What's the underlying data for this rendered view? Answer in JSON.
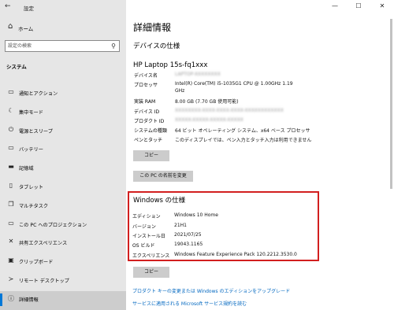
{
  "titlebar": {
    "back_icon": "back-arrow-icon",
    "app_title": "設定"
  },
  "sidebar": {
    "home_label": "ホーム",
    "search_placeholder": "設定の検索",
    "section_label": "システム",
    "items": [
      {
        "label": "通知とアクション",
        "icon": "notification-icon"
      },
      {
        "label": "集中モード",
        "icon": "moon-icon"
      },
      {
        "label": "電源とスリープ",
        "icon": "power-icon"
      },
      {
        "label": "バッテリー",
        "icon": "battery-icon"
      },
      {
        "label": "記憶域",
        "icon": "storage-icon"
      },
      {
        "label": "タブレット",
        "icon": "tablet-icon"
      },
      {
        "label": "マルチタスク",
        "icon": "multitask-icon"
      },
      {
        "label": "この PC へのプロジェクション",
        "icon": "projection-icon"
      },
      {
        "label": "共有エクスペリエンス",
        "icon": "share-icon"
      },
      {
        "label": "クリップボード",
        "icon": "clipboard-icon"
      },
      {
        "label": "リモート デスクトップ",
        "icon": "remote-desktop-icon"
      },
      {
        "label": "詳細情報",
        "icon": "info-icon",
        "selected": true
      }
    ]
  },
  "window_controls": {
    "minimize": "—",
    "maximize": "☐",
    "close": "✕"
  },
  "main": {
    "page_title": "詳細情報",
    "device_section_title": "デバイスの仕様",
    "device_name": "HP Laptop 15s-fq1xxx",
    "device_specs": [
      {
        "label": "デバイス名",
        "value": "LAPTOP-XXXXXXXX",
        "blurred": true
      },
      {
        "label": "プロセッサ",
        "value": "Intel(R) Core(TM) i5-1035G1 CPU @ 1.00GHz   1.19",
        "value2": "GHz"
      },
      {
        "label": "実装 RAM",
        "value": "8.00 GB (7.70 GB 使用可能)"
      },
      {
        "label": "デバイス ID",
        "value": "XXXXXXXX-XXXX-XXXX-XXXX-XXXXXXXXXXXX",
        "blurred": true
      },
      {
        "label": "プロダクト ID",
        "value": "XXXXX-XXXXX-XXXXX-XXXXX",
        "blurred": true
      },
      {
        "label": "システムの種類",
        "value": "64 ビット オペレーティング システム、x64 ベース プロセッサ"
      },
      {
        "label": "ペンとタッチ",
        "value": "このディスプレイでは、ペン入力とタッチ入力は利用できません"
      }
    ],
    "copy_button": "コピー",
    "rename_button": "この PC の名前を変更",
    "windows_section_title": "Windows の仕様",
    "windows_specs": [
      {
        "label": "エディション",
        "value": "Windows 10 Home"
      },
      {
        "label": "バージョン",
        "value": "21H1"
      },
      {
        "label": "インストール日",
        "value": "2021/07/25"
      },
      {
        "label": "OS ビルド",
        "value": "19043.1165"
      },
      {
        "label": "エクスペリエンス",
        "value": "Windows Feature Experience Pack 120.2212.3530.0"
      }
    ],
    "copy_button_2": "コピー",
    "links": [
      "プロダクト キーの変更または Windows のエディションをアップグレード",
      "サービスに適用される Microsoft サービス規約を読む"
    ]
  }
}
